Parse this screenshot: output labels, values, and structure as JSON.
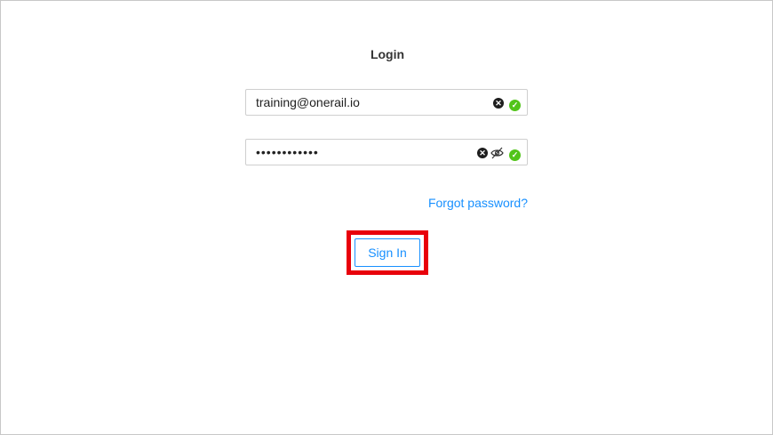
{
  "login": {
    "title": "Login",
    "email": {
      "value": "training@onerail.io"
    },
    "password": {
      "value": "••••••••••••"
    },
    "forgot_label": "Forgot password?",
    "signin_label": "Sign In"
  },
  "icons": {
    "clear": "close-circle-icon",
    "toggle_visibility": "eye-invisible-icon",
    "valid": "check-circle-icon"
  },
  "colors": {
    "accent": "#1890ff",
    "success": "#52c41a",
    "highlight": "#e8000b"
  }
}
